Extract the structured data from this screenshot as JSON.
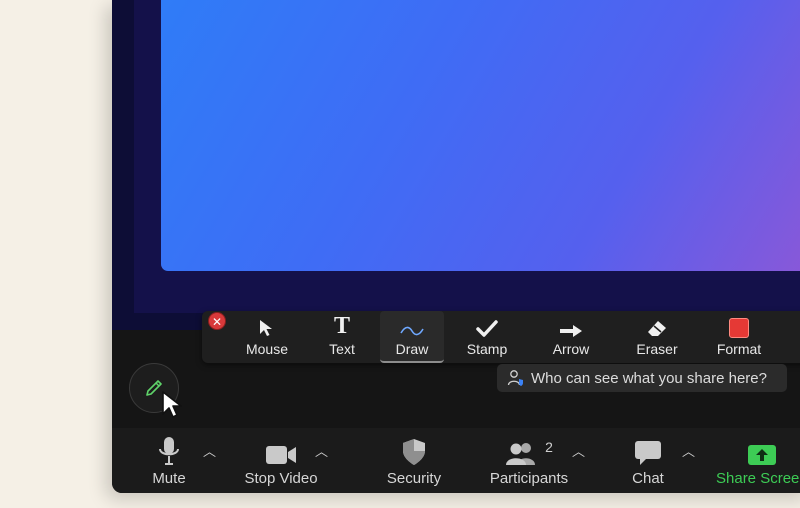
{
  "annotation_toolbar": {
    "close_symbol": "✕",
    "tools": [
      {
        "label": "Mouse",
        "icon": "mouse-pointer-icon"
      },
      {
        "label": "Text",
        "icon": "text-icon",
        "glyph": "T"
      },
      {
        "label": "Draw",
        "icon": "draw-squiggle-icon",
        "active": true
      },
      {
        "label": "Stamp",
        "icon": "checkmark-icon"
      },
      {
        "label": "Arrow",
        "icon": "arrow-icon"
      },
      {
        "label": "Eraser",
        "icon": "eraser-icon"
      },
      {
        "label": "Format",
        "icon": "format-swatch-icon"
      }
    ],
    "format_color": "#e53935"
  },
  "tooltip": {
    "text": "Who can see what you share here?"
  },
  "meeting_controls": {
    "mute_label": "Mute",
    "stop_video_label": "Stop Video",
    "security_label": "Security",
    "participants_label": "Participants",
    "participants_count": "2",
    "chat_label": "Chat",
    "share_label": "Share Scree",
    "share_color": "#3dcc55"
  },
  "colors": {
    "slide_gradient_start": "#2f7cf7",
    "slide_gradient_end": "#8a58d8",
    "toolbar_bg": "#1f1f1f",
    "control_bar_bg": "#1b1b1b"
  }
}
